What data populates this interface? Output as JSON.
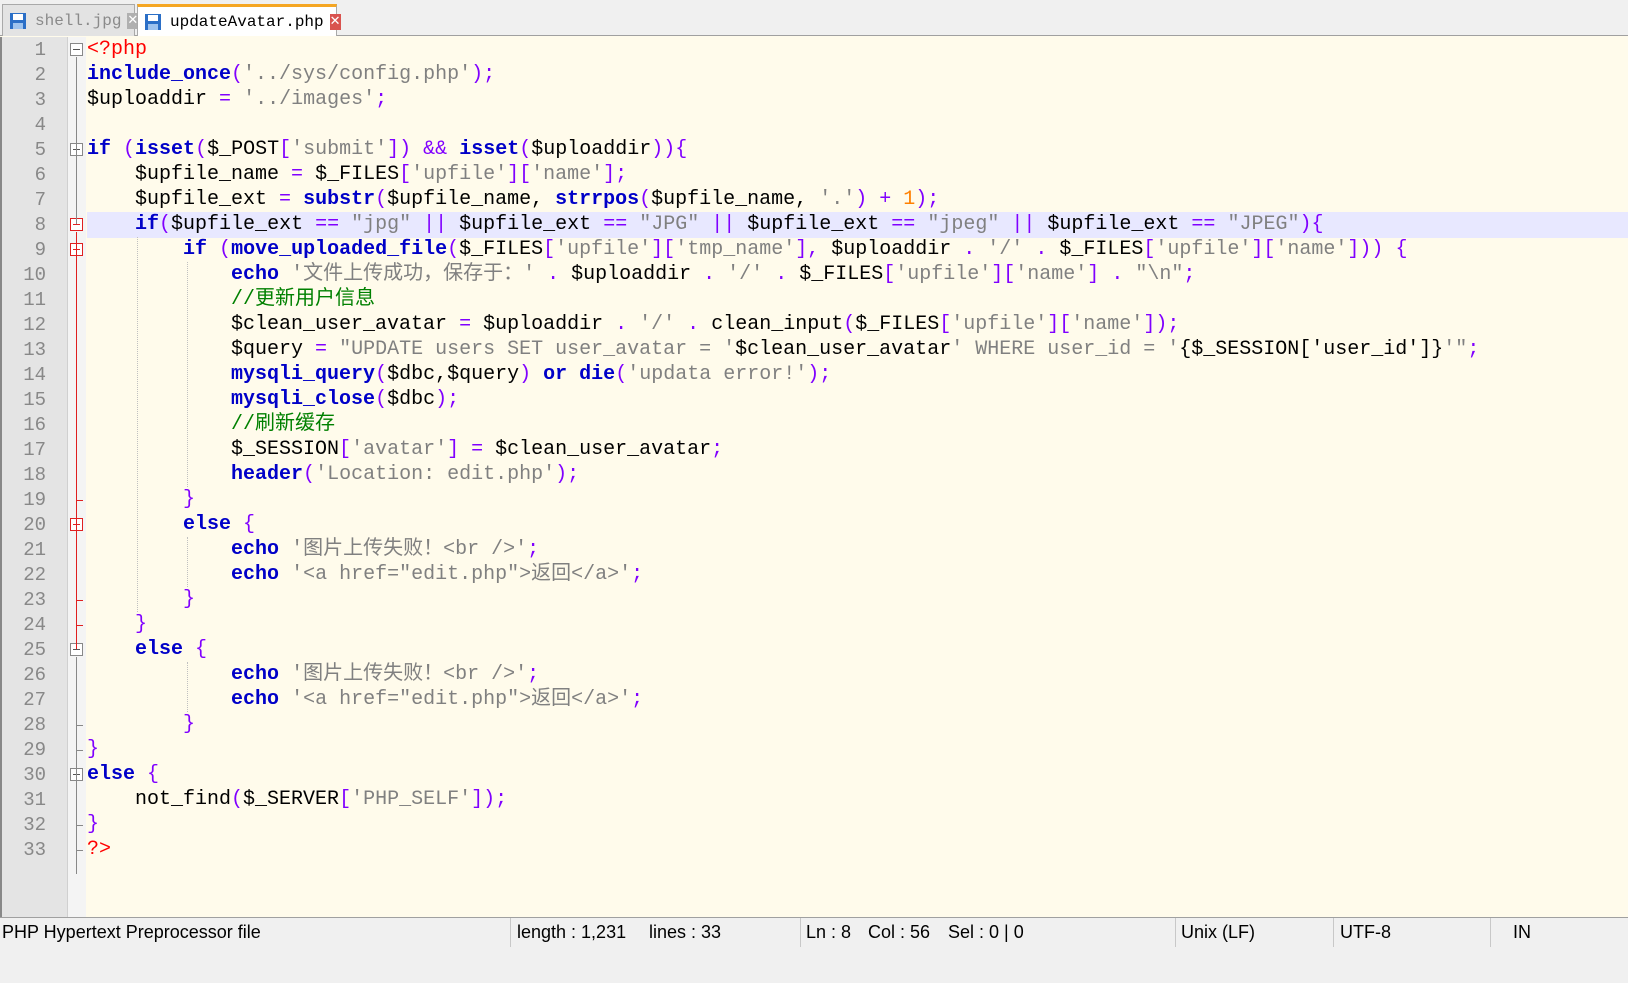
{
  "tabs": [
    {
      "label": "shell.jpg",
      "active": false
    },
    {
      "label": "updateAvatar.php",
      "active": true
    }
  ],
  "editor": {
    "highlighted_line": 8,
    "colors": {
      "keyword": "#0000c8",
      "string": "#808080",
      "operator": "#8000ff",
      "number": "#ff8000",
      "comment": "#008000",
      "php_tag": "#ff0000",
      "background": "#fffbeb",
      "current_line": "#e8e8ff"
    },
    "lines": [
      [
        [
          "t",
          "<?php"
        ]
      ],
      [
        [
          "k",
          "include_once"
        ],
        [
          "o",
          "("
        ],
        [
          "s",
          "'../sys/config.php'"
        ],
        [
          "o",
          ");"
        ]
      ],
      [
        [
          "x",
          "$uploaddir "
        ],
        [
          "o",
          "="
        ],
        [
          "x",
          " "
        ],
        [
          "s",
          "'../images'"
        ],
        [
          "o",
          ";"
        ]
      ],
      [],
      [
        [
          "k",
          "if"
        ],
        [
          "x",
          " "
        ],
        [
          "o",
          "("
        ],
        [
          "k",
          "isset"
        ],
        [
          "o",
          "("
        ],
        [
          "x",
          "$_POST"
        ],
        [
          "o",
          "["
        ],
        [
          "s",
          "'submit'"
        ],
        [
          "o",
          "])"
        ],
        [
          "x",
          " "
        ],
        [
          "o",
          "&&"
        ],
        [
          "x",
          " "
        ],
        [
          "k",
          "isset"
        ],
        [
          "o",
          "("
        ],
        [
          "x",
          "$uploaddir"
        ],
        [
          "o",
          "))"
        ],
        [
          "o",
          "{"
        ]
      ],
      [
        [
          "x",
          "    $upfile_name "
        ],
        [
          "o",
          "="
        ],
        [
          "x",
          " $_FILES"
        ],
        [
          "o",
          "["
        ],
        [
          "s",
          "'upfile'"
        ],
        [
          "o",
          "]["
        ],
        [
          "s",
          "'name'"
        ],
        [
          "o",
          "];"
        ]
      ],
      [
        [
          "x",
          "    $upfile_ext "
        ],
        [
          "o",
          "="
        ],
        [
          "x",
          " "
        ],
        [
          "k",
          "substr"
        ],
        [
          "o",
          "("
        ],
        [
          "x",
          "$upfile_name, "
        ],
        [
          "k",
          "strrpos"
        ],
        [
          "o",
          "("
        ],
        [
          "x",
          "$upfile_name, "
        ],
        [
          "s",
          "'.'"
        ],
        [
          "o",
          ")"
        ],
        [
          "x",
          " "
        ],
        [
          "o",
          "+"
        ],
        [
          "x",
          " "
        ],
        [
          "n",
          "1"
        ],
        [
          "o",
          ");"
        ]
      ],
      [
        [
          "x",
          "    "
        ],
        [
          "k",
          "if"
        ],
        [
          "o",
          "("
        ],
        [
          "x",
          "$upfile_ext "
        ],
        [
          "o",
          "=="
        ],
        [
          "x",
          " "
        ],
        [
          "s",
          "\"jpg\""
        ],
        [
          "x",
          " "
        ],
        [
          "o",
          "||"
        ],
        [
          "x",
          " $upfile_ext "
        ],
        [
          "o",
          "=="
        ],
        [
          "x",
          " "
        ],
        [
          "s",
          "\"JPG\""
        ],
        [
          "x",
          " "
        ],
        [
          "o",
          "||"
        ],
        [
          "x",
          " $upfile_ext "
        ],
        [
          "o",
          "=="
        ],
        [
          "x",
          " "
        ],
        [
          "s",
          "\"jpeg\""
        ],
        [
          "x",
          " "
        ],
        [
          "o",
          "||"
        ],
        [
          "x",
          " $upfile_ext "
        ],
        [
          "o",
          "=="
        ],
        [
          "x",
          " "
        ],
        [
          "s",
          "\"JPEG\""
        ],
        [
          "o",
          "){"
        ]
      ],
      [
        [
          "x",
          "        "
        ],
        [
          "k",
          "if"
        ],
        [
          "x",
          " "
        ],
        [
          "o",
          "("
        ],
        [
          "k",
          "move_uploaded_file"
        ],
        [
          "o",
          "("
        ],
        [
          "x",
          "$_FILES"
        ],
        [
          "o",
          "["
        ],
        [
          "s",
          "'upfile'"
        ],
        [
          "o",
          "]["
        ],
        [
          "s",
          "'tmp_name'"
        ],
        [
          "o",
          "],"
        ],
        [
          "x",
          " $uploaddir "
        ],
        [
          "o",
          "."
        ],
        [
          "x",
          " "
        ],
        [
          "s",
          "'/'"
        ],
        [
          "x",
          " "
        ],
        [
          "o",
          "."
        ],
        [
          "x",
          " $_FILES"
        ],
        [
          "o",
          "["
        ],
        [
          "s",
          "'upfile'"
        ],
        [
          "o",
          "]["
        ],
        [
          "s",
          "'name'"
        ],
        [
          "o",
          "]))"
        ],
        [
          "x",
          " "
        ],
        [
          "o",
          "{"
        ]
      ],
      [
        [
          "x",
          "            "
        ],
        [
          "k",
          "echo"
        ],
        [
          "x",
          " "
        ],
        [
          "s",
          "'文件上传成功，保存于：'"
        ],
        [
          "x",
          " "
        ],
        [
          "o",
          "."
        ],
        [
          "x",
          " $uploaddir "
        ],
        [
          "o",
          "."
        ],
        [
          "x",
          " "
        ],
        [
          "s",
          "'/'"
        ],
        [
          "x",
          " "
        ],
        [
          "o",
          "."
        ],
        [
          "x",
          " $_FILES"
        ],
        [
          "o",
          "["
        ],
        [
          "s",
          "'upfile'"
        ],
        [
          "o",
          "]["
        ],
        [
          "s",
          "'name'"
        ],
        [
          "o",
          "]"
        ],
        [
          "x",
          " "
        ],
        [
          "o",
          "."
        ],
        [
          "x",
          " "
        ],
        [
          "s",
          "\"\\n\""
        ],
        [
          "o",
          ";"
        ]
      ],
      [
        [
          "x",
          "            "
        ],
        [
          "c",
          "//更新用户信息"
        ]
      ],
      [
        [
          "x",
          "            $clean_user_avatar "
        ],
        [
          "o",
          "="
        ],
        [
          "x",
          " $uploaddir "
        ],
        [
          "o",
          "."
        ],
        [
          "x",
          " "
        ],
        [
          "s",
          "'/'"
        ],
        [
          "x",
          " "
        ],
        [
          "o",
          "."
        ],
        [
          "x",
          " clean_input"
        ],
        [
          "o",
          "("
        ],
        [
          "x",
          "$_FILES"
        ],
        [
          "o",
          "["
        ],
        [
          "s",
          "'upfile'"
        ],
        [
          "o",
          "]["
        ],
        [
          "s",
          "'name'"
        ],
        [
          "o",
          "]);"
        ]
      ],
      [
        [
          "x",
          "            $query "
        ],
        [
          "o",
          "="
        ],
        [
          "x",
          " "
        ],
        [
          "s",
          "\"UPDATE users SET user_avatar = '"
        ],
        [
          "x",
          "$clean_user_avatar"
        ],
        [
          "s",
          "' WHERE user_id = '"
        ],
        [
          "x",
          "{$_SESSION['user_id']}"
        ],
        [
          "s",
          "'\""
        ],
        [
          "o",
          ";"
        ]
      ],
      [
        [
          "x",
          "            "
        ],
        [
          "k",
          "mysqli_query"
        ],
        [
          "o",
          "("
        ],
        [
          "x",
          "$dbc,$query"
        ],
        [
          "o",
          ")"
        ],
        [
          "x",
          " "
        ],
        [
          "k",
          "or"
        ],
        [
          "x",
          " "
        ],
        [
          "k",
          "die"
        ],
        [
          "o",
          "("
        ],
        [
          "s",
          "'updata error!'"
        ],
        [
          "o",
          ");"
        ]
      ],
      [
        [
          "x",
          "            "
        ],
        [
          "k",
          "mysqli_close"
        ],
        [
          "o",
          "("
        ],
        [
          "x",
          "$dbc"
        ],
        [
          "o",
          ");"
        ]
      ],
      [
        [
          "x",
          "            "
        ],
        [
          "c",
          "//刷新缓存"
        ]
      ],
      [
        [
          "x",
          "            $_SESSION"
        ],
        [
          "o",
          "["
        ],
        [
          "s",
          "'avatar'"
        ],
        [
          "o",
          "]"
        ],
        [
          "x",
          " "
        ],
        [
          "o",
          "="
        ],
        [
          "x",
          " $clean_user_avatar"
        ],
        [
          "o",
          ";"
        ]
      ],
      [
        [
          "x",
          "            "
        ],
        [
          "k",
          "header"
        ],
        [
          "o",
          "("
        ],
        [
          "s",
          "'Location: edit.php'"
        ],
        [
          "o",
          ");"
        ]
      ],
      [
        [
          "x",
          "        "
        ],
        [
          "o",
          "}"
        ]
      ],
      [
        [
          "x",
          "        "
        ],
        [
          "k",
          "else"
        ],
        [
          "x",
          " "
        ],
        [
          "o",
          "{"
        ]
      ],
      [
        [
          "x",
          "            "
        ],
        [
          "k",
          "echo"
        ],
        [
          "x",
          " "
        ],
        [
          "s",
          "'图片上传失败！<br />'"
        ],
        [
          "o",
          ";"
        ]
      ],
      [
        [
          "x",
          "            "
        ],
        [
          "k",
          "echo"
        ],
        [
          "x",
          " "
        ],
        [
          "s",
          "'<a href=\"edit.php\">返回</a>'"
        ],
        [
          "o",
          ";"
        ]
      ],
      [
        [
          "x",
          "        "
        ],
        [
          "o",
          "}"
        ]
      ],
      [
        [
          "x",
          "    "
        ],
        [
          "o",
          "}"
        ]
      ],
      [
        [
          "x",
          "    "
        ],
        [
          "k",
          "else"
        ],
        [
          "x",
          " "
        ],
        [
          "o",
          "{"
        ]
      ],
      [
        [
          "x",
          "            "
        ],
        [
          "k",
          "echo"
        ],
        [
          "x",
          " "
        ],
        [
          "s",
          "'图片上传失败！<br />'"
        ],
        [
          "o",
          ";"
        ]
      ],
      [
        [
          "x",
          "            "
        ],
        [
          "k",
          "echo"
        ],
        [
          "x",
          " "
        ],
        [
          "s",
          "'<a href=\"edit.php\">返回</a>'"
        ],
        [
          "o",
          ";"
        ]
      ],
      [
        [
          "x",
          "        "
        ],
        [
          "o",
          "}"
        ]
      ],
      [
        [
          "o",
          "}"
        ]
      ],
      [
        [
          "k",
          "else"
        ],
        [
          "x",
          " "
        ],
        [
          "o",
          "{"
        ]
      ],
      [
        [
          "x",
          "    not_find"
        ],
        [
          "o",
          "("
        ],
        [
          "x",
          "$_SERVER"
        ],
        [
          "o",
          "["
        ],
        [
          "s",
          "'PHP_SELF'"
        ],
        [
          "o",
          "]);"
        ]
      ],
      [
        [
          "o",
          "}"
        ]
      ],
      [
        [
          "t",
          "?>"
        ]
      ]
    ]
  },
  "status": {
    "file_type": "PHP Hypertext Preprocessor file",
    "length": "length : 1,231",
    "lines": "lines : 33",
    "ln": "Ln : 8",
    "col": "Col : 56",
    "sel": "Sel : 0 | 0",
    "eol": "Unix (LF)",
    "encoding": "UTF-8",
    "mode": "IN"
  }
}
